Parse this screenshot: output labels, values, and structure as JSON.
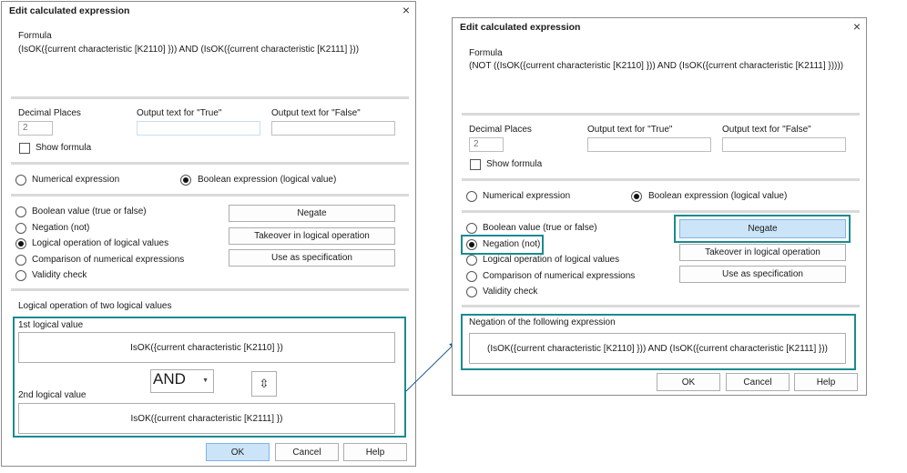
{
  "colors": {
    "highlight": "#1c8a8f",
    "default_button": "#cce4f7",
    "separator": "#d9d9d9"
  },
  "left": {
    "title": "Edit calculated expression",
    "close": "×",
    "formula_label": "Formula",
    "formula": "(IsOK({current characteristic [K2110] })) AND (IsOK({current characteristic [K2111] }))",
    "decimal_label": "Decimal Places",
    "decimal_value": "2",
    "true_label": "Output text for \"True\"",
    "false_label": "Output text for \"False\"",
    "true_value": "",
    "false_value": "",
    "show_formula": "Show formula",
    "mode_numerical": "Numerical expression",
    "mode_boolean": "Boolean expression (logical value)",
    "options": [
      "Boolean value (true or false)",
      "Negation (not)",
      "Logical operation of logical values",
      "Comparison of numerical expressions",
      "Validity check"
    ],
    "negate": "Negate",
    "takeover": "Takeover in logical operation",
    "use_spec": "Use as specification",
    "section_title": "Logical operation of two logical values",
    "first_label": "1st logical value",
    "first_value": "IsOK({current characteristic [K2110] })",
    "operator": "AND",
    "swap_icon": "⇳",
    "second_label": "2nd logical value",
    "second_value": "IsOK({current characteristic [K2111] })",
    "ok": "OK",
    "cancel": "Cancel",
    "help": "Help"
  },
  "right": {
    "title": "Edit calculated expression",
    "close": "×",
    "formula_label": "Formula",
    "formula": "(NOT ((IsOK({current characteristic [K2110] })) AND (IsOK({current characteristic [K2111] }))))",
    "decimal_label": "Decimal Places",
    "decimal_value": "2",
    "true_label": "Output text for \"True\"",
    "false_label": "Output text for \"False\"",
    "true_value": "",
    "false_value": "",
    "show_formula": "Show formula",
    "mode_numerical": "Numerical expression",
    "mode_boolean": "Boolean expression (logical value)",
    "options": [
      "Boolean value (true or false)",
      "Negation (not)",
      "Logical operation of logical values",
      "Comparison of numerical expressions",
      "Validity check"
    ],
    "negate": "Negate",
    "takeover": "Takeover in logical operation",
    "use_spec": "Use as specification",
    "section_title": "Negation of the following expression",
    "neg_value": "(IsOK({current characteristic [K2110] })) AND (IsOK({current characteristic [K2111] }))",
    "ok": "OK",
    "cancel": "Cancel",
    "help": "Help"
  }
}
